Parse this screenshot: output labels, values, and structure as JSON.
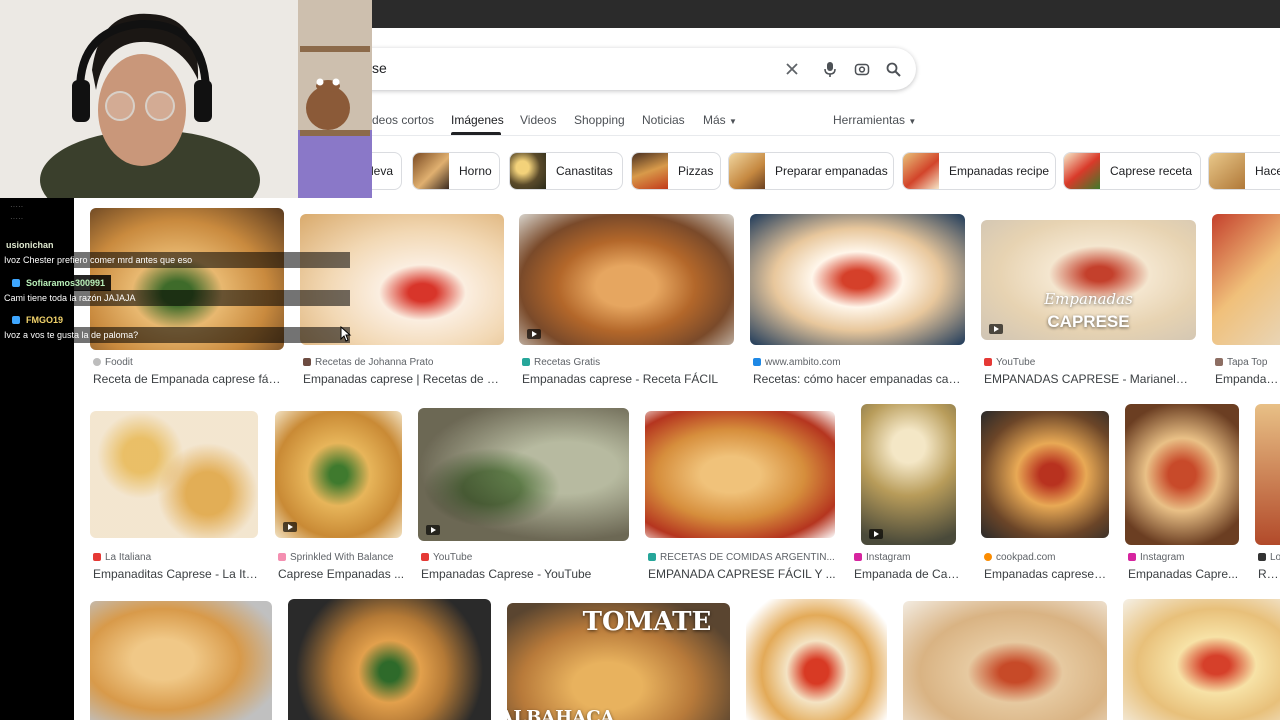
{
  "search": {
    "query_fragment": "se"
  },
  "tabs": {
    "videos_cortos": "deos cortos",
    "imagenes": "Imágenes",
    "videos": "Videos",
    "shopping": "Shopping",
    "noticias": "Noticias",
    "mas": "Más",
    "herramientas": "Herramientas"
  },
  "chips": [
    {
      "label": "leva"
    },
    {
      "label": "Horno"
    },
    {
      "label": "Canastitas"
    },
    {
      "label": "Pizzas"
    },
    {
      "label": "Preparar empanadas"
    },
    {
      "label": "Empanadas recipe"
    },
    {
      "label": "Caprese receta"
    },
    {
      "label": "Hace"
    }
  ],
  "results": [
    {
      "source": "Foodit",
      "caption": "Receta de Empanada caprese fácil..."
    },
    {
      "source": "Recetas de Johanna Prato",
      "caption": "Empanadas caprese | Recetas de Jo..."
    },
    {
      "source": "Recetas Gratis",
      "caption": "Empanadas caprese - Receta FÁCIL"
    },
    {
      "source": "www.ambito.com",
      "caption": "Recetas: cómo hacer empanadas capr..."
    },
    {
      "source": "YouTube",
      "caption": "EMPANADAS CAPRESE - Marianela ..."
    },
    {
      "source": "Tapa Top",
      "caption": "Empandas C"
    },
    {
      "source": "La Italiana",
      "caption": "Empanaditas Caprese - La Ita..."
    },
    {
      "source": "Sprinkled With Balance",
      "caption": "Caprese Empanadas ..."
    },
    {
      "source": "YouTube",
      "caption": "Empanadas Caprese - YouTube"
    },
    {
      "source": "RECETAS DE COMIDAS ARGENTIN...",
      "caption": "EMPANADA CAPRESE FÁCIL Y ..."
    },
    {
      "source": "Instagram",
      "caption": "Empanada de Cap..."
    },
    {
      "source": "cookpad.com",
      "caption": "Empanadas caprese: ..."
    },
    {
      "source": "Instagram",
      "caption": "Empanadas Capre..."
    },
    {
      "source": "Lo",
      "caption": "Rece"
    }
  ],
  "overlays": {
    "empanadas": "Empanadas",
    "caprese": "CAPRESE",
    "tomate": "TOMATE",
    "albahaca": "ALBAHACA"
  },
  "chat": [
    {
      "user": "usionichan",
      "message": "Ivoz Chester prefiero comer mrd antes que eso",
      "user_color": "#dfe8cf"
    },
    {
      "user": "Sofiaramos300991",
      "message": "Cami tiene toda la razón JAJAJA",
      "user_color": "#b9f0b9"
    },
    {
      "user": "FMGO19",
      "message": "Ivoz a vos te gusta la de paloma?",
      "user_color": "#f2d36b"
    }
  ],
  "colors": {
    "accent_text": "#202124",
    "muted": "#5f6368",
    "chip_border": "#dadce0"
  }
}
